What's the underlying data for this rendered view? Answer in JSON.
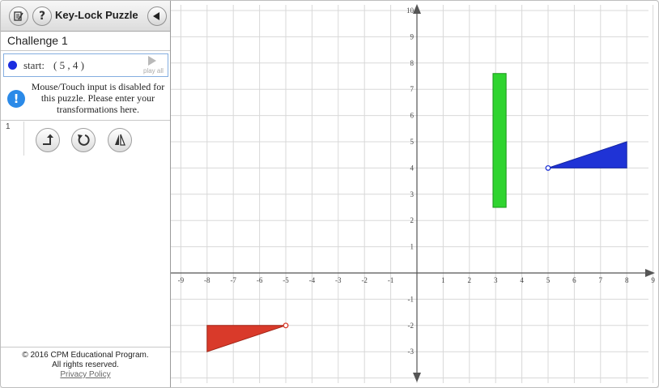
{
  "app": {
    "title": "Key-Lock Puzzle",
    "icons": {
      "notes": "notes-icon",
      "help": "question-icon",
      "back": "back-triangle-icon"
    }
  },
  "challenge": {
    "label": "Challenge 1"
  },
  "start": {
    "label": "start:",
    "value": "( 5 , 4 )",
    "dot_color": "#1b2de0",
    "play_label": "play all"
  },
  "notice": {
    "icon": "!",
    "text": "Mouse/Touch input is disabled for this puzzle. Please enter your transformations here."
  },
  "steps": [
    {
      "number": "1",
      "tools": [
        "translate-icon",
        "rotate-icon",
        "reflect-icon"
      ]
    }
  ],
  "footer": {
    "copyright": "© 2016 CPM Educational Program.",
    "rights": "All rights reserved.",
    "privacy": "Privacy Policy"
  },
  "graph": {
    "x_range": [
      -9,
      9
    ],
    "y_range": [
      -3,
      10
    ],
    "x_ticks": [
      "-9",
      "-8",
      "-7",
      "-6",
      "-5",
      "-4",
      "-3",
      "-2",
      "-1",
      "1",
      "2",
      "3",
      "4",
      "5",
      "6",
      "7",
      "8",
      "9"
    ],
    "y_ticks": [
      "-3",
      "-2",
      "-1",
      "1",
      "2",
      "3",
      "4",
      "5",
      "6",
      "7",
      "8",
      "9",
      "10"
    ],
    "grid": true,
    "shapes": {
      "green_rectangle": {
        "color": "#2fd42f",
        "points": [
          [
            2.9,
            2.5
          ],
          [
            3.4,
            2.5
          ],
          [
            3.4,
            7.6
          ],
          [
            2.9,
            7.6
          ]
        ]
      },
      "blue_triangle": {
        "color": "#1f33d6",
        "points": [
          [
            5,
            4
          ],
          [
            8,
            4
          ],
          [
            8,
            5
          ]
        ],
        "key_point": [
          5,
          4
        ]
      },
      "red_triangle": {
        "color": "#d93a2a",
        "points": [
          [
            -8,
            -2
          ],
          [
            -5,
            -2
          ],
          [
            -8,
            -3
          ]
        ],
        "key_point": [
          -5,
          -2
        ]
      }
    }
  }
}
